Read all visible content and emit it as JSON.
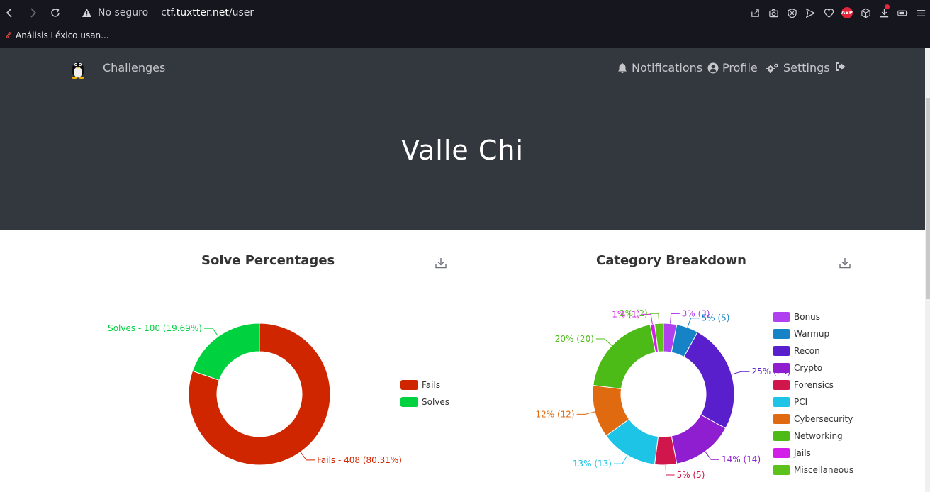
{
  "browser": {
    "security_label": "No seguro",
    "url_host_prefix": "ctf.",
    "url_host_main": "tuxtter.net",
    "url_path": "/user",
    "bookmark_label": "Análisis Léxico usan..."
  },
  "nav": {
    "challenges": "Challenges",
    "notifications": "Notifications",
    "profile": "Profile",
    "settings": "Settings"
  },
  "hero": {
    "username": "Valle Chi"
  },
  "colors": {
    "hero_bg": "#33373e",
    "fails": "#cf2600",
    "solves": "#00d13f"
  },
  "chart_data": [
    {
      "type": "pie",
      "title": "Solve Percentages",
      "labels": [
        "Fails",
        "Solves"
      ],
      "values": [
        408,
        100
      ],
      "percents": [
        80.31,
        19.69
      ],
      "colors": [
        "#cf2600",
        "#00d13f"
      ],
      "slice_labels": [
        "Fails - 408 (80.31%)",
        "Solves - 100 (19.69%)"
      ],
      "legend": [
        "Fails",
        "Solves"
      ],
      "legend_position": "right"
    },
    {
      "type": "pie",
      "title": "Category Breakdown",
      "labels": [
        "Bonus",
        "Warmup",
        "Recon",
        "Crypto",
        "Forensics",
        "PCI",
        "Cybersecurity",
        "Networking",
        "Jails",
        "Miscellaneous"
      ],
      "values": [
        3,
        5,
        25,
        14,
        5,
        13,
        12,
        20,
        1,
        2
      ],
      "colors": [
        "#b040f0",
        "#1683c6",
        "#5a1fcc",
        "#8e1ed0",
        "#d0164a",
        "#1ec4e6",
        "#e06a10",
        "#4cbb17",
        "#d21ee8",
        "#5cc21b"
      ],
      "slice_labels": [
        "3% (3)",
        "5% (5)",
        "25% (25)",
        "14% (14)",
        "5% (5)",
        "13% (13)",
        "12% (12)",
        "20% (20)",
        "1% (1)",
        "2% (2)"
      ],
      "legend": [
        "Bonus",
        "Warmup",
        "Recon",
        "Crypto",
        "Forensics",
        "PCI",
        "Cybersecurity",
        "Networking",
        "Jails",
        "Miscellaneous"
      ],
      "legend_position": "right"
    }
  ]
}
